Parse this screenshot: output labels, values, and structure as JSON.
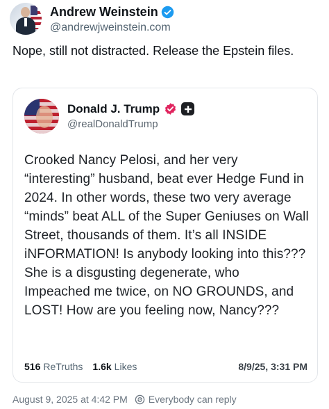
{
  "author": {
    "display_name": "Andrew Weinstein",
    "handle": "@andrewjweinstein.com",
    "verified_icon": "verified-check-icon"
  },
  "post": {
    "text": "Nope, still not distracted. Release the Epstein files."
  },
  "quoted_post": {
    "author": {
      "display_name": "Donald J. Trump",
      "handle": "@realDonaldTrump",
      "verified_icon": "verified-badge-icon",
      "extra_badge_icon": "plus-badge-icon"
    },
    "text": "Crooked Nancy Pelosi, and her very “interesting” husband, beat ever Hedge Fund in 2024. In other words, these two very average “minds” beat ALL of the Super Geniuses on Wall Street, thousands of them. It’s all INSIDE iNFORMATION! Is anybody looking into this??? She is a disgusting degenerate, who Impeached me twice, on NO GROUNDS, and LOST! How are you feeling now, Nancy???",
    "stats": {
      "retruths_count": "516",
      "retruths_label": "ReTruths",
      "likes_count": "1.6k",
      "likes_label": "Likes"
    },
    "date": "8/9/25, 3:31 PM"
  },
  "footer": {
    "timestamp": "August 9, 2025 at 4:42 PM",
    "reply_setting": "Everybody can reply",
    "reply_icon": "reply-setting-icon"
  },
  "colors": {
    "verified_blue": "#1d9bf0",
    "truth_verified_red": "#e0245e",
    "muted_text": "#536471"
  }
}
